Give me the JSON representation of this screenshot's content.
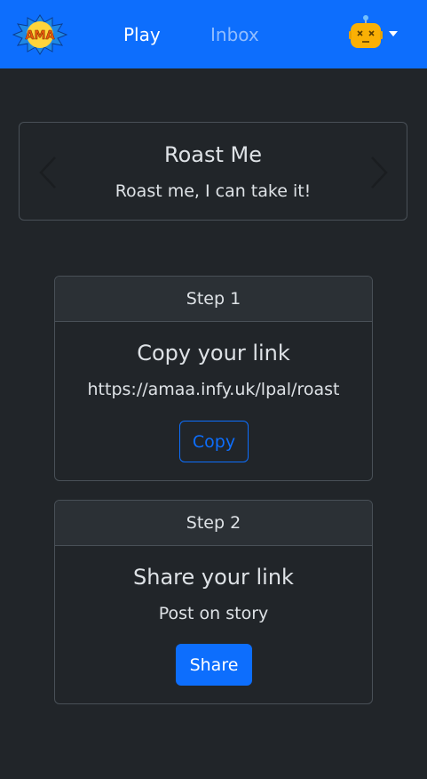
{
  "nav": {
    "logo_text": "AMA",
    "play_label": "Play",
    "inbox_label": "Inbox",
    "avatar_icon": "robot-avatar-icon",
    "brand_color": "#0d6efd"
  },
  "carousel": {
    "title": "Roast Me",
    "subtitle": "Roast me, I can take it!",
    "prev_icon": "chevron-left-icon",
    "next_icon": "chevron-right-icon"
  },
  "steps": [
    {
      "header": "Step 1",
      "title": "Copy your link",
      "text": "https://amaa.infy.uk/lpal/roast",
      "button_label": "Copy"
    },
    {
      "header": "Step 2",
      "title": "Share your link",
      "text": "Post on story",
      "button_label": "Share"
    }
  ]
}
